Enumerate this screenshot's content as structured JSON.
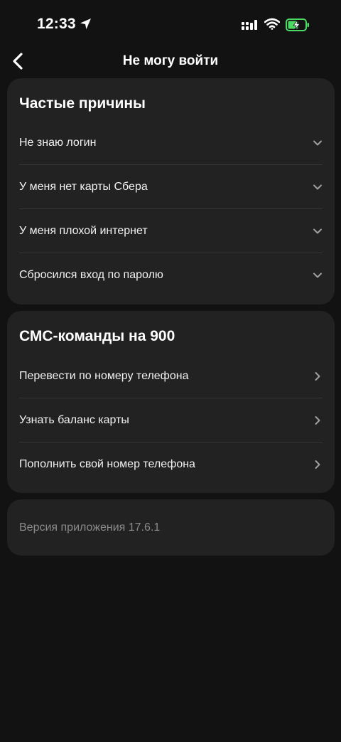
{
  "status_bar": {
    "time": "12:33",
    "icons": [
      "location-arrow-icon",
      "signal-icon",
      "wifi-icon",
      "battery-charging-icon"
    ],
    "battery_color": "#4cd964"
  },
  "nav": {
    "back_icon": "chevron-left-icon",
    "title": "Не могу войти"
  },
  "reasons": {
    "title": "Частые причины",
    "items": [
      {
        "label": "Не знаю логин",
        "icon": "chevron-down-icon"
      },
      {
        "label": "У меня нет карты Сбера",
        "icon": "chevron-down-icon"
      },
      {
        "label": "У меня плохой интернет",
        "icon": "chevron-down-icon"
      },
      {
        "label": "Сбросился вход по паролю",
        "icon": "chevron-down-icon"
      }
    ]
  },
  "sms": {
    "title": "СМС-команды на 900",
    "items": [
      {
        "label": "Перевести по номеру телефона",
        "icon": "chevron-right-icon"
      },
      {
        "label": "Узнать баланс карты",
        "icon": "chevron-right-icon"
      },
      {
        "label": "Пополнить свой номер телефона",
        "icon": "chevron-right-icon"
      }
    ]
  },
  "version": {
    "text": "Версия приложения 17.6.1"
  },
  "colors": {
    "background": "#121212",
    "card": "#222222",
    "divider": "#363636",
    "muted_text": "#8a8a8a"
  }
}
